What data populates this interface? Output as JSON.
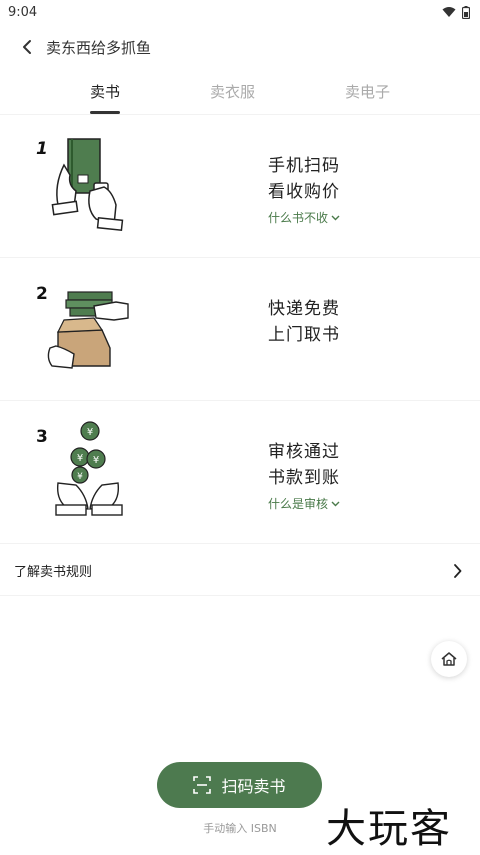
{
  "status_bar": {
    "time": "9:04"
  },
  "header": {
    "title": "卖东西给多抓鱼"
  },
  "tabs": [
    {
      "label": "卖书",
      "active": true
    },
    {
      "label": "卖衣服",
      "active": false
    },
    {
      "label": "卖电子",
      "active": false
    }
  ],
  "steps": [
    {
      "number": "1",
      "line1": "手机扫码",
      "line2": "看收购价",
      "link": "什么书不收"
    },
    {
      "number": "2",
      "line1": "快递免费",
      "line2": "上门取书",
      "link": ""
    },
    {
      "number": "3",
      "line1": "审核通过",
      "line2": "书款到账",
      "link": "什么是审核"
    }
  ],
  "rules": {
    "label": "了解卖书规则"
  },
  "actions": {
    "scan_label": "扫码卖书",
    "manual_label": "手动输入 ISBN"
  },
  "watermark": "大玩客",
  "colors": {
    "accent": "#4d7a4f",
    "link": "#4a7a4a"
  }
}
